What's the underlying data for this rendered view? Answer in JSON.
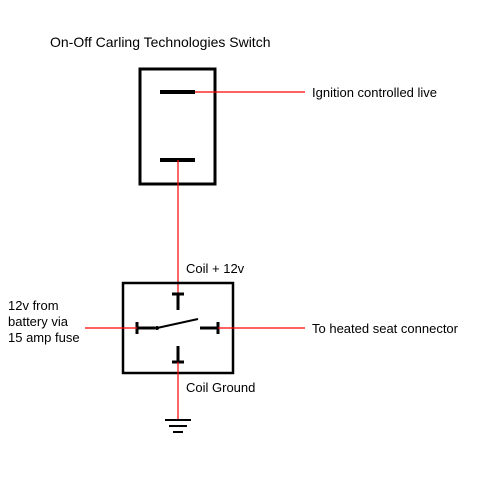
{
  "title": "On-Off Carling Technologies Switch",
  "labels": {
    "ignition": "Ignition controlled live",
    "coil_plus": "Coil + 12v",
    "battery_in_l1": "12v from",
    "battery_in_l2": "battery via",
    "battery_in_l3": "15 amp fuse",
    "out": "To heated seat connector",
    "coil_ground": "Coil Ground"
  },
  "diagram": {
    "components": [
      {
        "name": "carling-switch",
        "type": "switch",
        "terminals": 2
      },
      {
        "name": "relay",
        "type": "relay",
        "coil_voltage": "12v",
        "fuse": "15A"
      }
    ],
    "wires": [
      {
        "from": "ignition-live",
        "to": "switch-top",
        "color": "red"
      },
      {
        "from": "switch-bottom",
        "to": "relay-coil-plus",
        "color": "red"
      },
      {
        "from": "battery-12v-fused",
        "to": "relay-input",
        "color": "red"
      },
      {
        "from": "relay-output",
        "to": "heated-seat-connector",
        "color": "red"
      },
      {
        "from": "relay-coil-ground",
        "to": "ground",
        "color": "red"
      }
    ]
  }
}
